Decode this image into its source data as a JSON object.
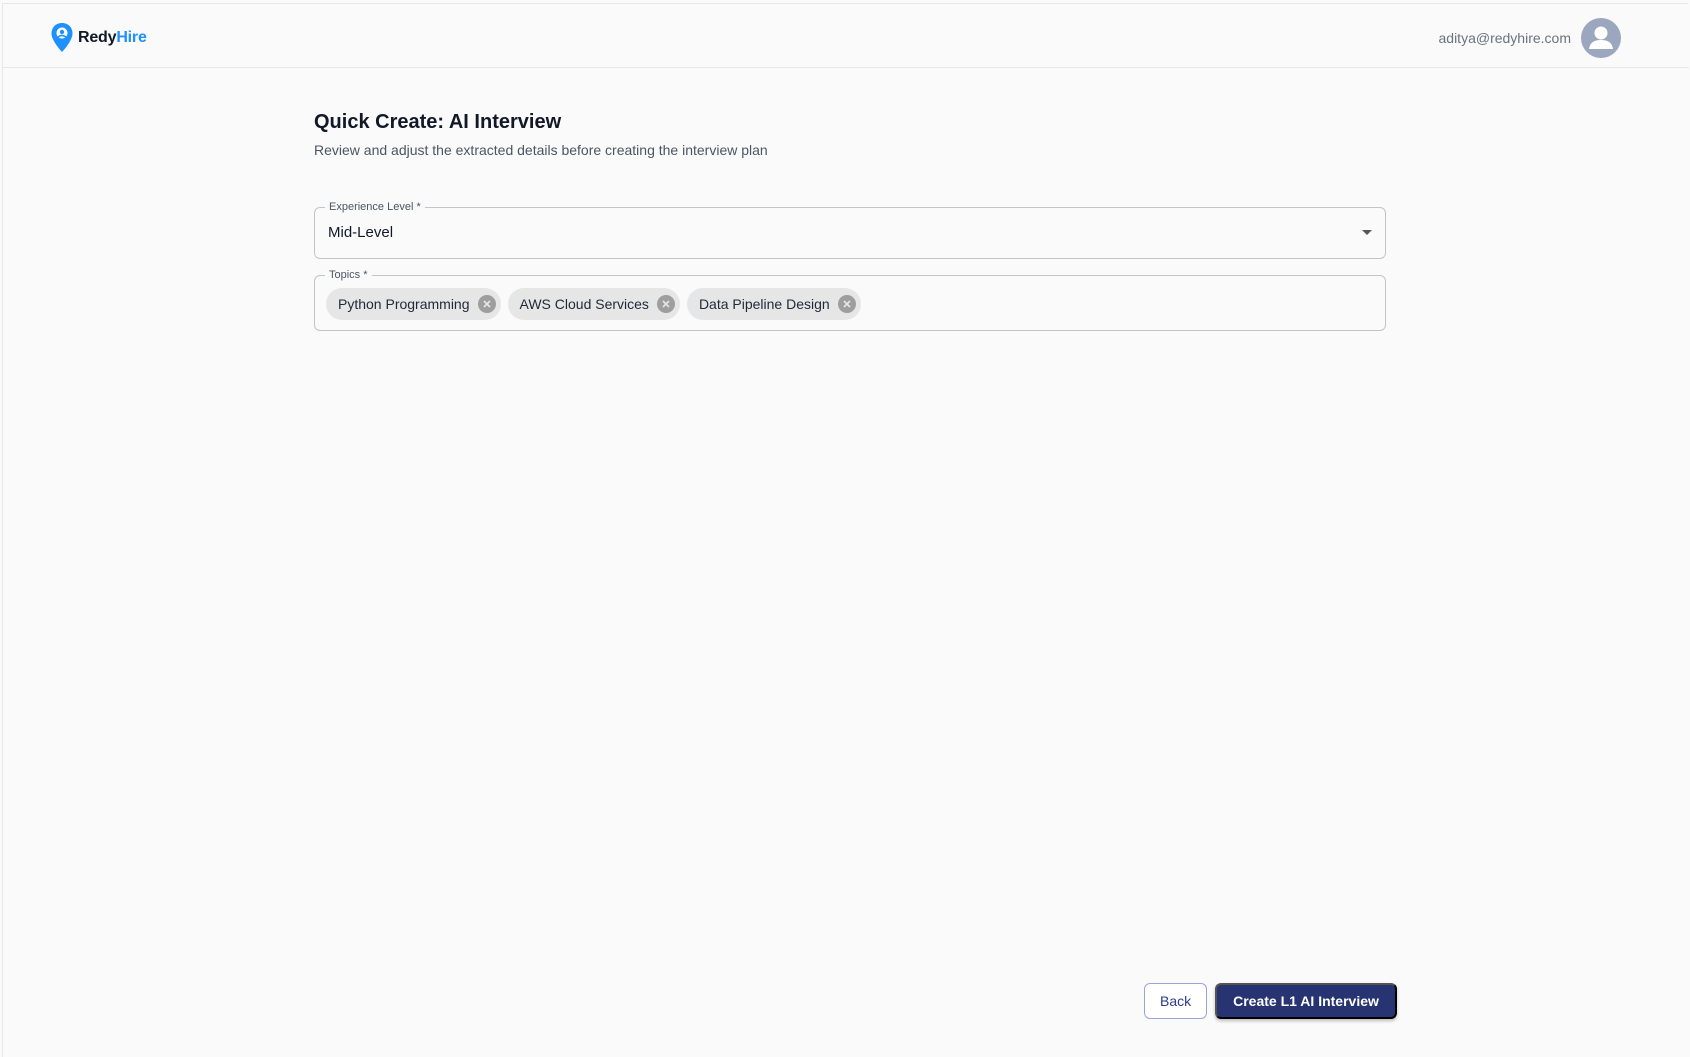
{
  "header": {
    "brand_part1": "Redy",
    "brand_part2": "Hire",
    "user_email": "aditya@redyhire.com"
  },
  "page": {
    "title": "Quick Create: AI Interview",
    "subtitle": "Review and adjust the extracted details before creating the interview plan"
  },
  "form": {
    "experience": {
      "label": "Experience Level *",
      "value": "Mid-Level"
    },
    "topics": {
      "label": "Topics *",
      "chips": [
        "Python Programming",
        "AWS Cloud Services",
        "Data Pipeline Design"
      ]
    }
  },
  "actions": {
    "back_label": "Back",
    "create_label": "Create L1 AI Interview"
  },
  "colors": {
    "brand_blue": "#1e90ff",
    "primary_button": "#283471"
  }
}
